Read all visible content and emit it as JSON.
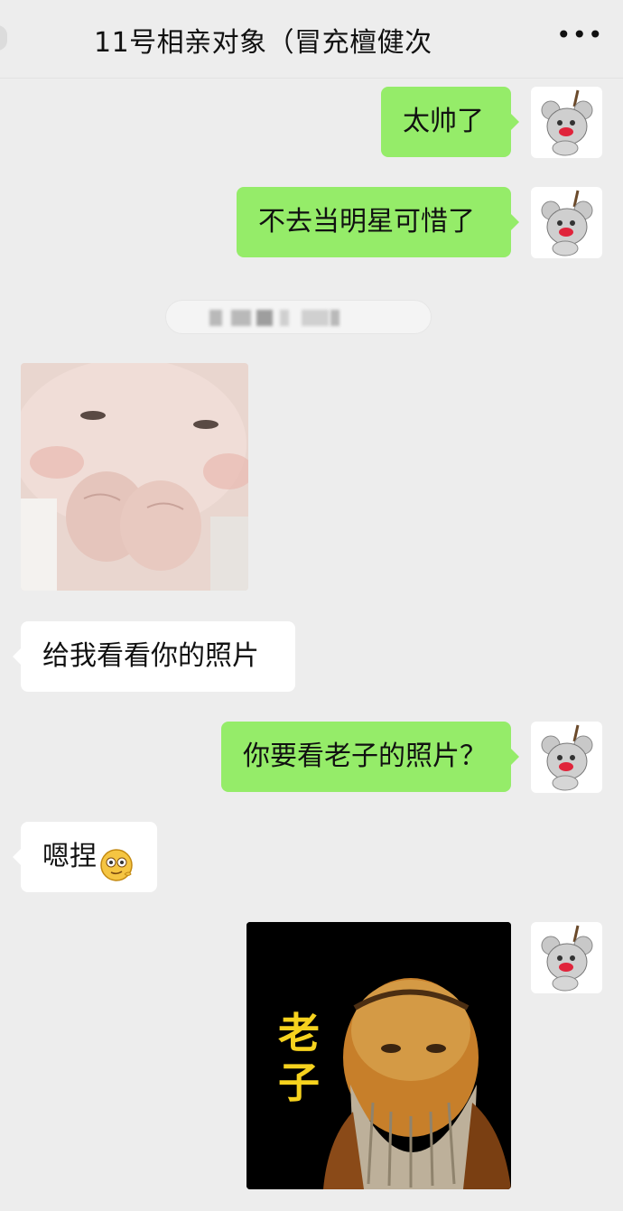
{
  "header": {
    "title": "11号相亲对象（冒充檀健次",
    "more_label": "•••"
  },
  "messages": {
    "m1": "太帅了",
    "m2": "不去当明星可惜了",
    "m4": "给我看看你的照片",
    "m5": "你要看老子的照片？",
    "m6": "嗯捏"
  },
  "stickers": {
    "laozi": {
      "text_line1": "老",
      "text_line2": "子"
    }
  },
  "icons": {
    "avatar": "cartoon-mouse-avatar-icon",
    "inline_emoji": "smirking-emoji-icon"
  },
  "colors": {
    "sent_bubble": "#95ec69",
    "received_bubble": "#ffffff",
    "chat_background": "#ededed"
  }
}
